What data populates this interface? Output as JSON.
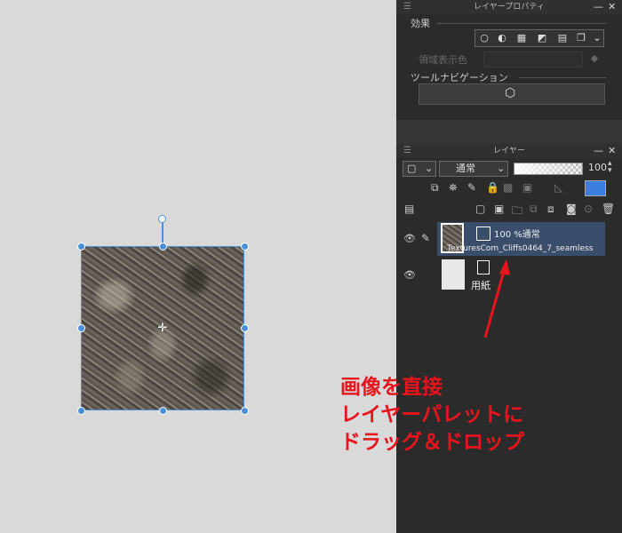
{
  "layer_property_panel": {
    "title": "レイヤープロパティ",
    "effects_label": "効果",
    "effect_icons": [
      "circle-icon",
      "half-circle-icon",
      "dots-icon",
      "triangle-icon",
      "grid-icon",
      "copy-icon",
      "chevron-down-icon"
    ],
    "area_color_label": "領域表示色",
    "tool_nav_label": "ツールナビゲーション"
  },
  "layer_panel": {
    "title": "レイヤー",
    "blend_mode": "通常",
    "opacity_value": "100",
    "layers": [
      {
        "opacity_blend": "100 %通常",
        "name": "TexturesCom_Cliffs0464_7_seamless",
        "selected": true
      },
      {
        "name": "用紙",
        "selected": false
      }
    ]
  },
  "annotation": {
    "line1": "画像を直接",
    "line2": "レイヤーパレットに",
    "line3": "ドラッグ＆ドロップ",
    "color": "#e8141c"
  },
  "colors": {
    "selection": "#4a90d9",
    "selected_layer": "#3a4e6c"
  }
}
